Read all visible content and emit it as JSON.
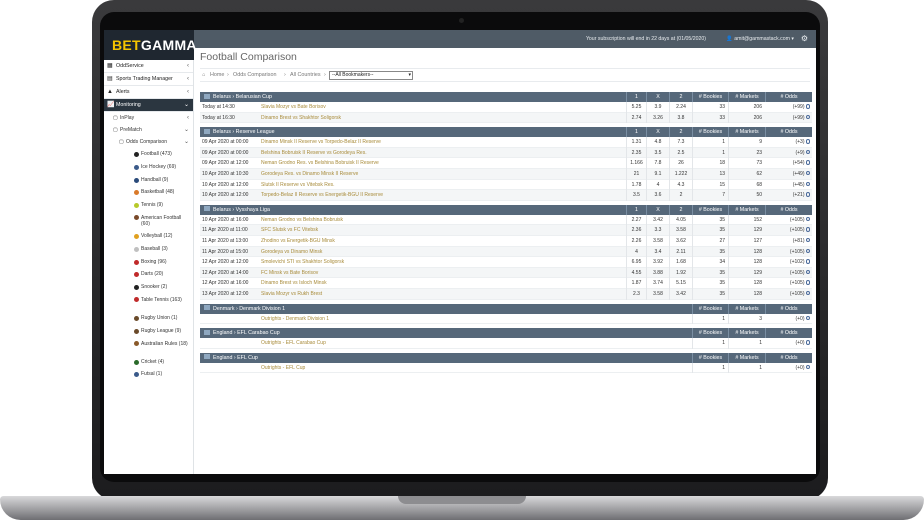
{
  "brand": {
    "logo_part1": "BET",
    "logo_part2": "GAMMA"
  },
  "topbar": {
    "subscription": "Your subscription will end in 22 days at (01/05/2020)",
    "user_email": "amit@gammastack.com"
  },
  "sidebar": {
    "items": [
      {
        "label": "OddService"
      },
      {
        "label": "Sports Trading Manager"
      },
      {
        "label": "Alerts"
      },
      {
        "label": "Monitoring"
      }
    ],
    "inplay": "InPlay",
    "prematch": "PreMatch",
    "odds_comparison": "Odds Comparison",
    "sports": [
      {
        "label": "Football (473)",
        "color": "#222"
      },
      {
        "label": "Ice Hockey (69)",
        "color": "#3b5b8a"
      },
      {
        "label": "Handball (9)",
        "color": "#2a4a7a"
      },
      {
        "label": "Basketball (48)",
        "color": "#d97a2a"
      },
      {
        "label": "Tennis (9)",
        "color": "#b7c92a"
      },
      {
        "label": "American Football (60)",
        "color": "#7a4a2a"
      },
      {
        "label": "Volleyball (12)",
        "color": "#e0a020"
      },
      {
        "label": "Baseball (3)",
        "color": "#c0c0c0"
      },
      {
        "label": "Boxing (96)",
        "color": "#c02a2a"
      },
      {
        "label": "Darts (20)",
        "color": "#c02a2a"
      },
      {
        "label": "Snooker (2)",
        "color": "#222"
      },
      {
        "label": "Table Tennis (163)",
        "color": "#c02a2a"
      },
      {
        "label": "Rugby Union (1)",
        "color": "#6a4a2a"
      },
      {
        "label": "Rugby League (9)",
        "color": "#6a4a2a"
      },
      {
        "label": "Australian Rules (18)",
        "color": "#8a5a2a"
      },
      {
        "label": "Cricket (4)",
        "color": "#2a6a2a"
      },
      {
        "label": "Futsal (1)",
        "color": "#3a5a8a"
      }
    ]
  },
  "main": {
    "title": "Football Comparison",
    "breadcrumb": {
      "home": "Home",
      "odds": "Odds Comparison",
      "countries": "All Countries",
      "select": "--All Bookmakers--"
    }
  },
  "columns": {
    "one": "1",
    "x": "X",
    "two": "2",
    "bookies": "# Bookies",
    "markets": "# Markets",
    "odds": "# Odds"
  },
  "leagues": [
    {
      "name": "Belarus › Belarusian Cup",
      "type": "match",
      "rows": [
        {
          "date": "Today at 14:30",
          "match": "Slavia Mozyr vs Bate Borisov",
          "one": "5.25",
          "x": "3.9",
          "two": "2.24",
          "bookies": "33",
          "markets": "206",
          "odds": "(+99)"
        },
        {
          "date": "Today at 16:30",
          "match": "Dinamo Brest vs Shakhtor Soligorsk",
          "one": "2.74",
          "x": "3.26",
          "two": "3.8",
          "bookies": "33",
          "markets": "206",
          "odds": "(+99)"
        }
      ]
    },
    {
      "name": "Belarus › Reserve League",
      "type": "match",
      "rows": [
        {
          "date": "09 Apr 2020 at 00:00",
          "match": "Dinamo Minsk II Reserve vs Torpedo-Belaz II Reserve",
          "one": "1.31",
          "x": "4.8",
          "two": "7.3",
          "bookies": "1",
          "markets": "9",
          "odds": "(+3)"
        },
        {
          "date": "09 Apr 2020 at 00:00",
          "match": "Belshina Bobruisk II Reserve vs Gorodeya Res.",
          "one": "2.35",
          "x": "3.5",
          "two": "2.5",
          "bookies": "1",
          "markets": "23",
          "odds": "(+9)"
        },
        {
          "date": "09 Apr 2020 at 12:00",
          "match": "Neman Grodno Res. vs Belshina Bobruisk II Reserve",
          "one": "1.166",
          "x": "7.8",
          "two": "26",
          "bookies": "18",
          "markets": "73",
          "odds": "(+54)"
        },
        {
          "date": "10 Apr 2020 at 10:30",
          "match": "Gorodeya Res. vs Dinamo Minsk II Reserve",
          "one": "21",
          "x": "9.1",
          "two": "1.222",
          "bookies": "13",
          "markets": "62",
          "odds": "(+49)"
        },
        {
          "date": "10 Apr 2020 at 12:00",
          "match": "Slutsk II Reserve vs Vitebsk Res.",
          "one": "1.78",
          "x": "4",
          "two": "4.3",
          "bookies": "15",
          "markets": "68",
          "odds": "(+45)"
        },
        {
          "date": "10 Apr 2020 at 12:00",
          "match": "Torpedo-Belaz II Reserve vs Energetik-BGU II Reserve",
          "one": "3.5",
          "x": "3.6",
          "two": "2",
          "bookies": "7",
          "markets": "50",
          "odds": "(+21)"
        }
      ]
    },
    {
      "name": "Belarus › Vysshaya Liga",
      "type": "match",
      "rows": [
        {
          "date": "10 Apr 2020 at 16:00",
          "match": "Neman Grodno vs Belshina Bobruisk",
          "one": "2.27",
          "x": "3.42",
          "two": "4.05",
          "bookies": "35",
          "markets": "152",
          "odds": "(+105)"
        },
        {
          "date": "11 Apr 2020 at 11:00",
          "match": "SFC Slutsk vs FC Vitebsk",
          "one": "2.36",
          "x": "3.3",
          "two": "3.58",
          "bookies": "35",
          "markets": "129",
          "odds": "(+105)"
        },
        {
          "date": "11 Apr 2020 at 13:00",
          "match": "Zhodino vs Energetik-BGU Minsk",
          "one": "2.26",
          "x": "3.58",
          "two": "3.62",
          "bookies": "27",
          "markets": "127",
          "odds": "(+81)"
        },
        {
          "date": "11 Apr 2020 at 15:00",
          "match": "Gorodeya vs Dinamo Minsk",
          "one": "4",
          "x": "3.4",
          "two": "2.11",
          "bookies": "35",
          "markets": "128",
          "odds": "(+105)"
        },
        {
          "date": "12 Apr 2020 at 12:00",
          "match": "Smolevichi STI vs Shakhtor Soligorsk",
          "one": "6.95",
          "x": "3.92",
          "two": "1.68",
          "bookies": "34",
          "markets": "128",
          "odds": "(+102)"
        },
        {
          "date": "12 Apr 2020 at 14:00",
          "match": "FC Minsk vs Bate Borisov",
          "one": "4.55",
          "x": "3.88",
          "two": "1.92",
          "bookies": "35",
          "markets": "129",
          "odds": "(+105)"
        },
        {
          "date": "12 Apr 2020 at 16:00",
          "match": "Dinamo Brest vs Isloch Minsk",
          "one": "1.87",
          "x": "3.74",
          "two": "5.15",
          "bookies": "35",
          "markets": "128",
          "odds": "(+105)"
        },
        {
          "date": "13 Apr 2020 at 12:00",
          "match": "Slavia Mozyr vs Rukh Brest",
          "one": "2.3",
          "x": "3.58",
          "two": "3.42",
          "bookies": "35",
          "markets": "128",
          "odds": "(+105)"
        }
      ]
    },
    {
      "name": "Denmark › Denmark Division 1",
      "type": "outright",
      "rows": [
        {
          "match": "Outrights - Denmark Division 1",
          "bookies": "1",
          "markets": "3",
          "odds": "(+0)"
        }
      ]
    },
    {
      "name": "England › EFL Carabao Cup",
      "type": "outright",
      "rows": [
        {
          "match": "Outrights - EFL Carabao Cup",
          "bookies": "1",
          "markets": "1",
          "odds": "(+0)"
        }
      ]
    },
    {
      "name": "England › EFL Cup",
      "type": "outright",
      "rows": [
        {
          "match": "Outrights - EFL Cup",
          "bookies": "1",
          "markets": "1",
          "odds": "(+0)"
        }
      ]
    }
  ]
}
